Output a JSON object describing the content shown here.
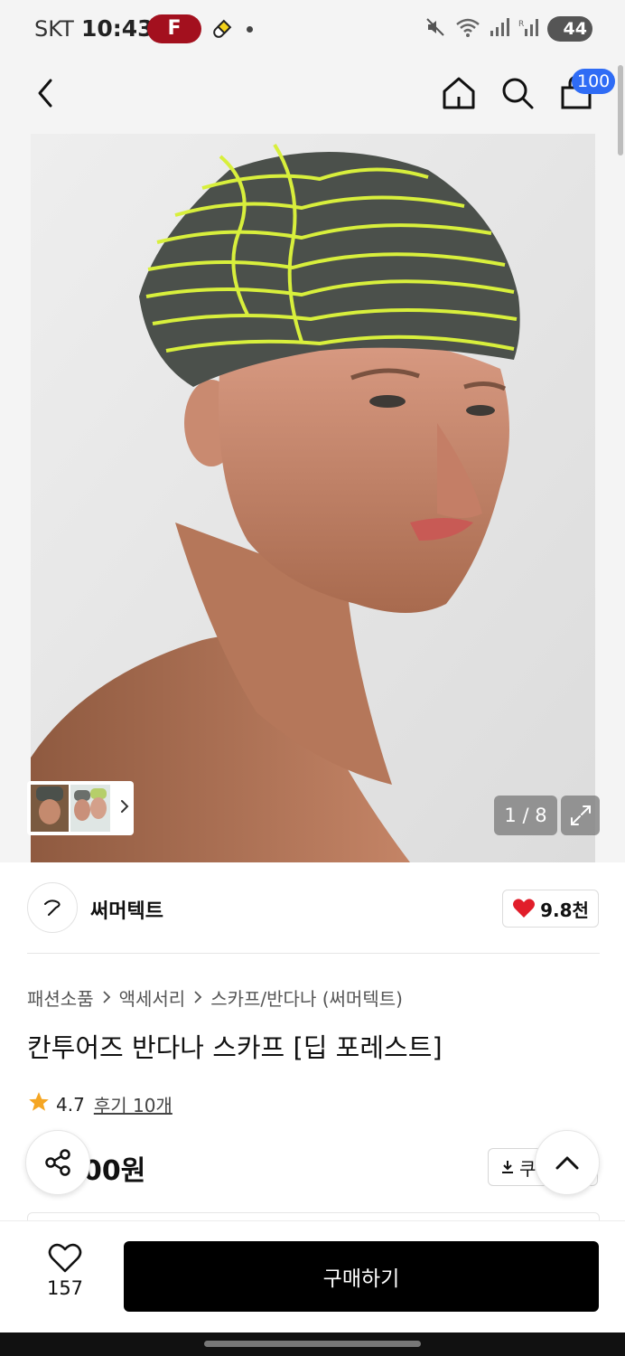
{
  "status_bar": {
    "carrier": "SKT",
    "time": "10:43",
    "app_badge": "F",
    "battery": "44"
  },
  "header": {
    "icons": [
      "back-icon",
      "home-icon",
      "search-icon",
      "shopping-bag-icon"
    ],
    "cart_count": "100"
  },
  "gallery": {
    "counter": "1 / 8",
    "current_index": 1,
    "total": 8,
    "colors": {
      "scarf_base": "#4b504b",
      "scarf_stripe": "#d8ef3c",
      "background": "#e8e8e8"
    }
  },
  "brand": {
    "name": "써머텍트",
    "likes": "9.8천"
  },
  "product": {
    "breadcrumb": [
      "패션소품",
      "액세서리",
      "스카프/반다나 (써머텍트)"
    ],
    "title": "칸투어즈 반다나 스카프 [딥 포레스트]",
    "rating": "4.7",
    "reviews": "후기 10개",
    "price_visible": "00원",
    "coupon_label": "쿠"
  },
  "bottom_bar": {
    "wish_count": "157",
    "buy_label": "구매하기"
  },
  "accent_colors": {
    "cart_badge": "#2f6cf5",
    "heart": "#e11d2a",
    "star": "#f5a623",
    "buy_button": "#000000"
  }
}
